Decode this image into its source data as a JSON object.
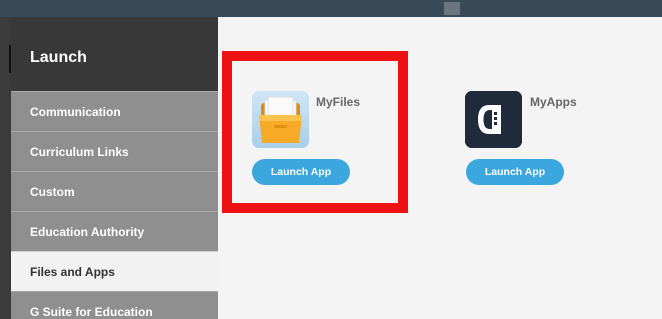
{
  "sidebar": {
    "title": "Launch",
    "items": [
      {
        "label": "Communication"
      },
      {
        "label": "Curriculum Links"
      },
      {
        "label": "Custom"
      },
      {
        "label": "Education Authority"
      },
      {
        "label": "Files and Apps",
        "active": true
      },
      {
        "label": "G Suite for Education"
      }
    ]
  },
  "apps": [
    {
      "name": "MyFiles",
      "button": "Launch App",
      "icon": "folder-icon"
    },
    {
      "name": "MyApps",
      "button": "Launch App",
      "icon": "myapps-logo-icon"
    }
  ],
  "colors": {
    "highlight": "#ee1111",
    "button": "#3ca7de",
    "sidebar_header": "#383838",
    "sidebar_bg": "#8f8f8f"
  }
}
